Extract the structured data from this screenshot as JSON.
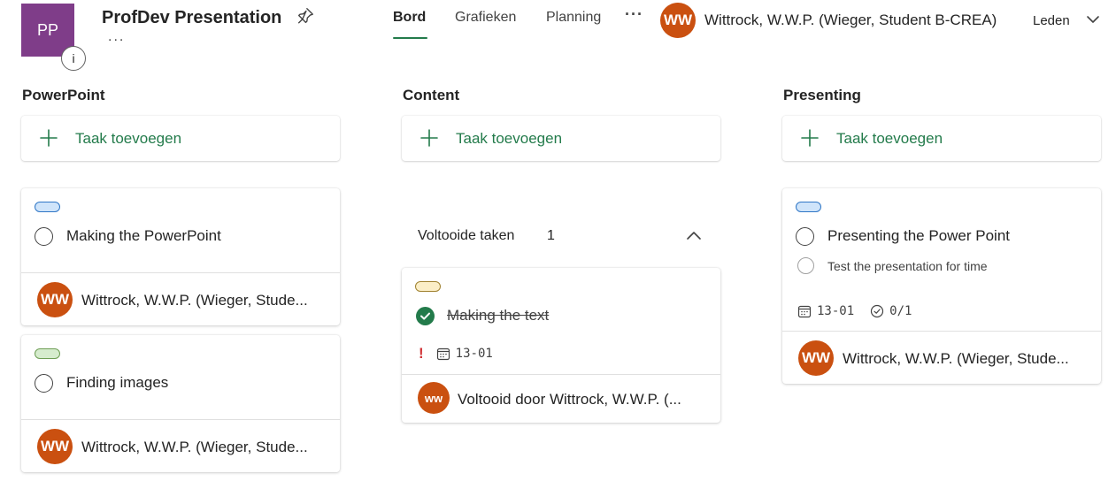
{
  "header": {
    "plan_initials": "PP",
    "info_glyph": "i",
    "plan_title": "ProfDev Presentation",
    "title_more": "...",
    "tabs": [
      {
        "label": "Bord",
        "active": true
      },
      {
        "label": "Grafieken",
        "active": false
      },
      {
        "label": "Planning",
        "active": false
      }
    ],
    "more_glyph": "···",
    "user": {
      "initials": "WW",
      "name": "Wittrock, W.W.P. (Wieger, Student B-CREA)"
    },
    "members_label": "Leden"
  },
  "buckets": [
    {
      "name": "PowerPoint",
      "add_task_label": "Taak toevoegen",
      "tasks": [
        {
          "label_color": "blue",
          "title": "Making the PowerPoint",
          "assignee_initials": "WW",
          "assignee_name": "Wittrock, W.W.P. (Wieger, Stude..."
        },
        {
          "label_color": "green",
          "title": "Finding images",
          "assignee_initials": "WW",
          "assignee_name": "Wittrock, W.W.P. (Wieger, Stude..."
        }
      ]
    },
    {
      "name": "Content",
      "add_task_label": "Taak toevoegen",
      "completed_label": "Voltooide taken",
      "completed_count": "1",
      "completed_tasks": [
        {
          "label_color": "yellow",
          "title": "Making the text",
          "priority_glyph": "!",
          "due_date": "13-01",
          "assignee_initials": "ww",
          "completed_by": "Voltooid door Wittrock, W.W.P. (..."
        }
      ]
    },
    {
      "name": "Presenting",
      "add_task_label": "Taak toevoegen",
      "tasks": [
        {
          "label_color": "blue",
          "title": "Presenting the Power Point",
          "subtask": "Test the presentation for time",
          "due_date": "13-01",
          "checklist": "0/1",
          "assignee_initials": "WW",
          "assignee_name": "Wittrock, W.W.P. (Wieger, Stude..."
        }
      ]
    }
  ],
  "colors": {
    "accent": "#237b4b",
    "plan_avatar": "#7f3d89",
    "user_avatar": "#ca5010",
    "priority": "#d13438"
  }
}
